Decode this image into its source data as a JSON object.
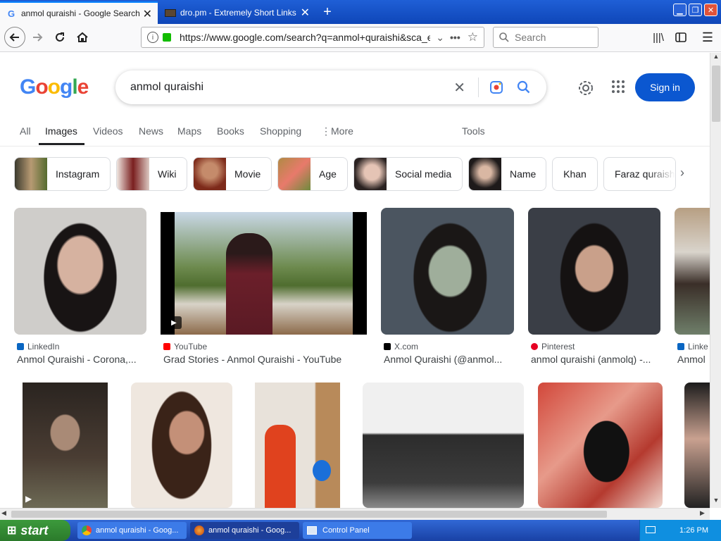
{
  "tabs": [
    {
      "label": "anmol quraishi - Google Search",
      "favicon": "G"
    },
    {
      "label": "dro.pm - Extremely Short Links",
      "favicon": ""
    }
  ],
  "new_tab_symbol": "+",
  "url": "https://www.google.com/search?q=anmol+quraishi&sca_es",
  "browser_search_placeholder": "Search",
  "google": {
    "query": "anmol quraishi",
    "sign_in": "Sign in",
    "tabs": [
      "All",
      "Images",
      "Videos",
      "News",
      "Maps",
      "Books",
      "Shopping",
      "More"
    ],
    "tools": "Tools",
    "chips": [
      "Instagram",
      "Wiki",
      "Movie",
      "Age",
      "Social media",
      "Name",
      "Khan",
      "Faraz quraishi"
    ]
  },
  "results_row1": [
    {
      "source": "LinkedIn",
      "title": "Anmol Quraishi - Corona,...",
      "source_color": "#0a66c2"
    },
    {
      "source": "YouTube",
      "title": "Grad Stories - Anmol Quraishi - YouTube",
      "source_color": "#ff0000"
    },
    {
      "source": "X.com",
      "title": "Anmol Quraishi (@anmol...",
      "source_color": "#000000"
    },
    {
      "source": "Pinterest",
      "title": "anmol quraishi (anmolq) -...",
      "source_color": "#e60023"
    },
    {
      "source": "Linke",
      "title": "Anmol",
      "source_color": "#0a66c2"
    }
  ],
  "taskbar": {
    "start": "start",
    "items": [
      "anmol quraishi - Goog...",
      "anmol quraishi - Goog...",
      "Control Panel"
    ],
    "clock": "1:26 PM"
  },
  "colors": {
    "accent": "#0b57d0",
    "taskbar": "#245edb"
  }
}
